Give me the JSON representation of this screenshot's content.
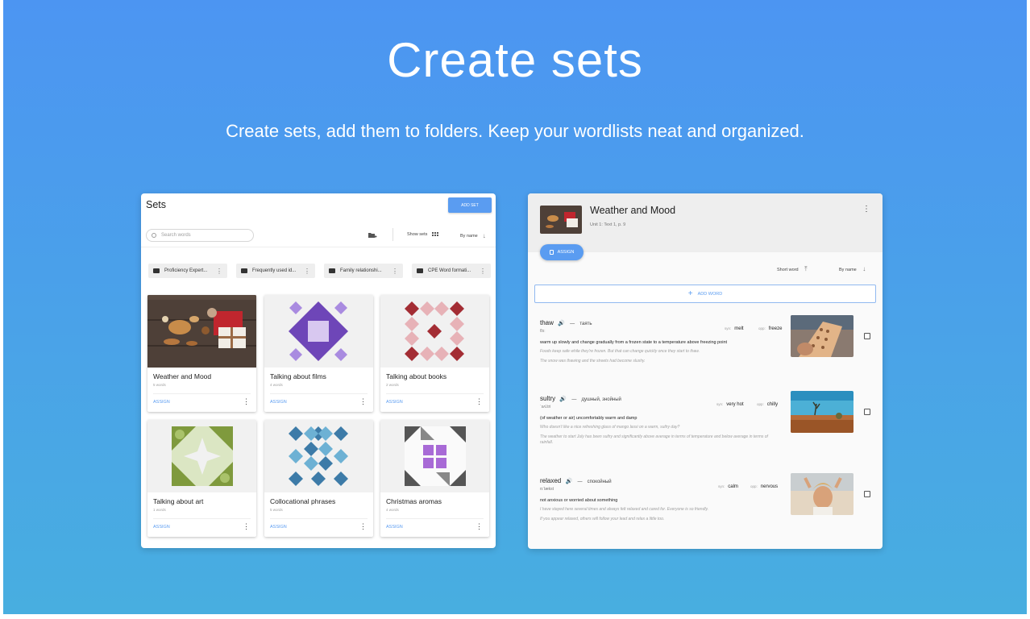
{
  "hero": {
    "title": "Create sets",
    "subtitle": "Create sets, add them to folders. Keep your wordlists neat and organized."
  },
  "sets_panel": {
    "title": "Sets",
    "add_button": "ADD SET",
    "search_placeholder": "Search words",
    "show_sets": "Show sets",
    "sort": "By name",
    "folders": [
      "Proficiency Expert...",
      "Frequently used id...",
      "Family relationshi...",
      "CPE Word formati..."
    ],
    "sets": [
      {
        "name": "Weather and Mood",
        "count": "5 words",
        "action": "ASSIGN"
      },
      {
        "name": "Talking about films",
        "count": "4 words",
        "action": "ASSIGN"
      },
      {
        "name": "Talking about books",
        "count": "2 words",
        "action": "ASSIGN"
      },
      {
        "name": "Talking about art",
        "count": "1 words",
        "action": "ASSIGN"
      },
      {
        "name": "Collocational phrases",
        "count": "5 words",
        "action": "ASSIGN"
      },
      {
        "name": "Christmas aromas",
        "count": "4 words",
        "action": "ASSIGN"
      }
    ]
  },
  "detail_panel": {
    "title": "Weather and Mood",
    "subtitle": "Unit 1: Text 1, p. 9",
    "assign_button": "ASSIGN",
    "sort_short": "Short word",
    "sort_name": "By name",
    "add_word": "ADD WORD",
    "words": [
      {
        "word": "thaw",
        "dash": "—",
        "translation": "таять",
        "phonetic": "θɔː",
        "syn_label": "syn:",
        "syn": "melt",
        "opp_label": "opp:",
        "opp": "freeze",
        "definition": "warm up slowly and change gradually from a frozen state to a temperature above freezing point",
        "examples": [
          "Foods keep safe while they're frozen. But that can change quickly once they start to thaw.",
          "The snow was thawing and the streets had become slushy."
        ]
      },
      {
        "word": "sultry",
        "dash": "—",
        "translation": "душный, знойный",
        "phonetic": "ˈsʌl.tri",
        "syn_label": "syn:",
        "syn": "very hot",
        "opp_label": "opp:",
        "opp": "chilly",
        "definition": "(of weather or air) uncomfortably warm and damp",
        "examples": [
          "Who doesn't like a nice refreshing glass of mango lassi on a warm, sultry day?",
          "The weather to start July has been sultry and significantly above average in terms of temperature and below average in terms of rainfall."
        ]
      },
      {
        "word": "relaxed",
        "dash": "—",
        "translation": "спокойный",
        "phonetic": "rɪˈlækst",
        "syn_label": "syn:",
        "syn": "calm",
        "opp_label": "opp:",
        "opp": "nervous",
        "definition": "not anxious or worried about something",
        "examples": [
          "I have stayed here several times and always felt relaxed and cared for. Everyone is so friendly.",
          "If you appear relaxed, others will follow your lead and relax a little too."
        ]
      }
    ]
  },
  "colors": {
    "accent": "#5a9cf1",
    "bg_top": "#4c95f2",
    "bg_bottom": "#48aee0"
  }
}
